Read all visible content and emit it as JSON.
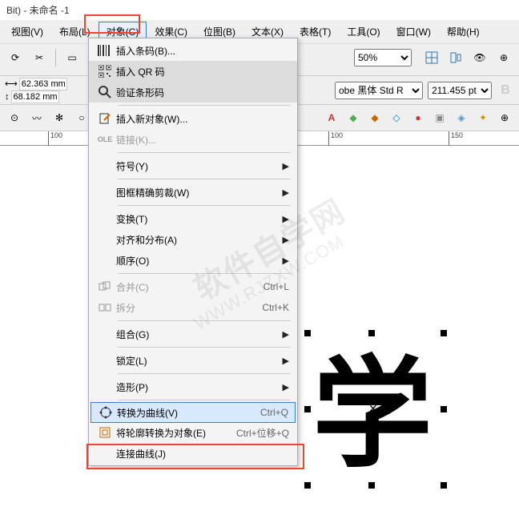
{
  "title": "Bit) - 未命名 -1",
  "menus": [
    "视图(V)",
    "布局(L)",
    "对象(C)",
    "效果(C)",
    "位图(B)",
    "文本(X)",
    "表格(T)",
    "工具(O)",
    "窗口(W)",
    "帮助(H)"
  ],
  "menu_active_index": 2,
  "zoom": "50%",
  "font_name": "obe 黑体 Std R",
  "font_size": "211.455 pt",
  "coords": {
    "w": "62.363 mm",
    "h": "68.182 mm"
  },
  "ruler": {
    "ticks": [
      100,
      100,
      150
    ]
  },
  "canvas_char": "学",
  "dropdown": {
    "items": [
      {
        "icon": "barcode",
        "label": "插入条码(B)..."
      },
      {
        "icon": "qr",
        "label": "插入 QR 码",
        "hover": true
      },
      {
        "icon": "verify",
        "label": "验证条形码",
        "hover": true
      },
      {
        "sep": true
      },
      {
        "icon": "ins",
        "label": "插入新对象(W)..."
      },
      {
        "icon": "ole",
        "label": "链接(K)...",
        "disabled": true
      },
      {
        "sep": true
      },
      {
        "label": "符号(Y)",
        "sub": true
      },
      {
        "sep": true
      },
      {
        "label": "图框精确剪裁(W)",
        "sub": true
      },
      {
        "sep": true
      },
      {
        "label": "变换(T)",
        "sub": true
      },
      {
        "label": "对齐和分布(A)",
        "sub": true
      },
      {
        "label": "顺序(O)",
        "sub": true
      },
      {
        "sep": true
      },
      {
        "icon": "merge",
        "label": "合并(C)",
        "shortcut": "Ctrl+L",
        "disabled": true
      },
      {
        "icon": "split",
        "label": "拆分",
        "shortcut": "Ctrl+K",
        "disabled": true
      },
      {
        "sep": true
      },
      {
        "label": "组合(G)",
        "sub": true
      },
      {
        "sep": true
      },
      {
        "label": "锁定(L)",
        "sub": true
      },
      {
        "sep": true
      },
      {
        "label": "造形(P)",
        "sub": true
      },
      {
        "sep": true
      },
      {
        "icon": "curve",
        "label": "转换为曲线(V)",
        "shortcut": "Ctrl+Q",
        "hl": true
      },
      {
        "icon": "outline",
        "label": "将轮廓转换为对象(E)",
        "shortcut": "Ctrl+位移+Q"
      },
      {
        "label": "连接曲线(J)"
      }
    ]
  },
  "watermark_main": "软件自学网",
  "watermark_sub": "WWW.RJZXW.COM"
}
